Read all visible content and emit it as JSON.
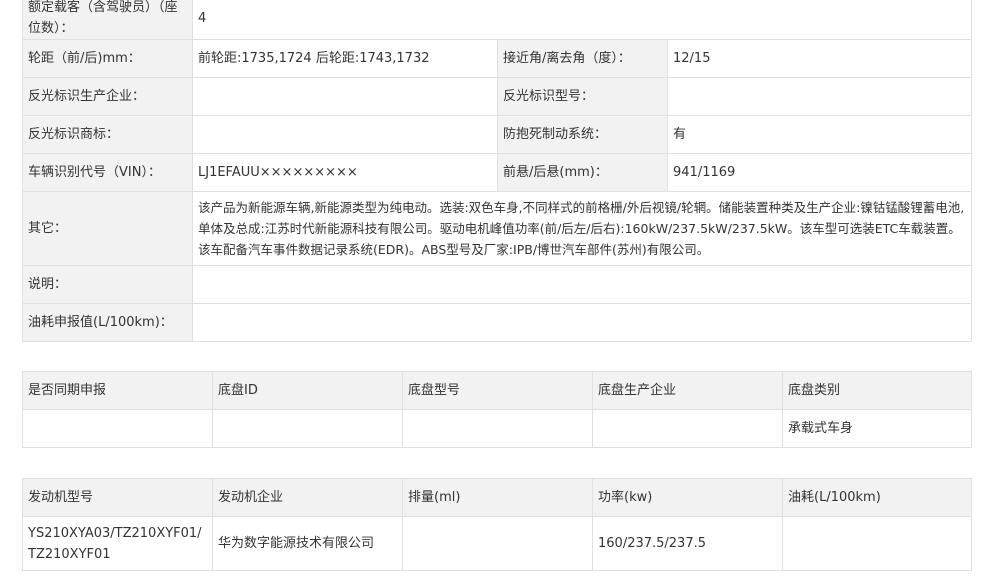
{
  "spec": {
    "seats": {
      "label": "额定载客（含驾驶员）（座位数）：",
      "value": "4"
    },
    "wheelbase": {
      "label": "轮距（前/后)mm：",
      "value": "前轮距:1735,1724 后轮距:1743,1732"
    },
    "approach": {
      "label": "接近角/离去角（度）：",
      "value": "12/15"
    },
    "reflector_maker": {
      "label": "反光标识生产企业：",
      "value": ""
    },
    "reflector_model": {
      "label": "反光标识型号：",
      "value": ""
    },
    "reflector_brand": {
      "label": "反光标识商标：",
      "value": ""
    },
    "abs": {
      "label": "防抱死制动系统：",
      "value": "有"
    },
    "vin": {
      "label": "车辆识别代号（VIN）：",
      "value": "LJ1EFAUU×××××××××"
    },
    "overhang": {
      "label": "前悬/后悬(mm)：",
      "value": "941/1169"
    },
    "other": {
      "label": "其它：",
      "value": "该产品为新能源车辆,新能源类型为纯电动。选装:双色车身,不同样式的前格栅/外后视镜/轮辋。储能装置种类及生产企业:镍钴锰酸锂蓄电池,单体及总成:江苏时代新能源科技有限公司。驱动电机峰值功率(前/后左/后右):160kW/237.5kW/237.5kW。该车型可选装ETC车载装置。该车配备汽车事件数据记录系统(EDR)。ABS型号及厂家:IPB/博世汽车部件(苏州)有限公司。"
    },
    "note": {
      "label": "说明：",
      "value": ""
    },
    "fuel": {
      "label": "油耗申报值(L/100km)：",
      "value": ""
    }
  },
  "chassis": {
    "headers": [
      "是否同期申报",
      "底盘ID",
      "底盘型号",
      "底盘生产企业",
      "底盘类别"
    ],
    "row": [
      "",
      "",
      "",
      "",
      "承载式车身"
    ]
  },
  "engine": {
    "headers": [
      "发动机型号",
      "发动机企业",
      "排量(ml)",
      "功率(kw)",
      "油耗(L/100km)"
    ],
    "row": [
      "YS210XYA03/TZ210XYF01/TZ210XYF01",
      "华为数字能源技术有限公司",
      "",
      "160/237.5/237.5",
      ""
    ]
  }
}
